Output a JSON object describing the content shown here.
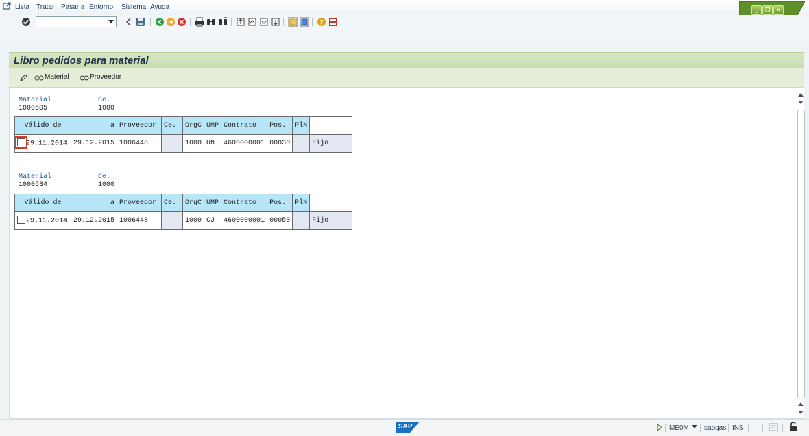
{
  "menu": [
    "Lista",
    "Tratar",
    "Pasar a",
    "Entorno",
    "Sistema",
    "Ayuda"
  ],
  "command_field": {
    "value": ""
  },
  "title": "Libro pedidos para material",
  "app_toolbar": {
    "edit_icon": "pencil-icon",
    "buttons": [
      "Material",
      "Proveedor"
    ]
  },
  "blocks": [
    {
      "material_label": "Material",
      "plant_label": "Ce.",
      "material": "1000505",
      "plant": "1000",
      "columns": [
        "Válido de",
        "a",
        "Proveedor",
        "Ce.",
        "OrgC",
        "UMP",
        "Contrato",
        "Pos.",
        "PlN"
      ],
      "row": {
        "valid_from": "29.11.2014",
        "valid_to": "29.12.2015",
        "vendor": "1006448",
        "plant": "",
        "purch_org": "1000",
        "unit": "UN",
        "contract": "4600000001",
        "item": "00030",
        "pln": "",
        "type": "Fijo"
      }
    },
    {
      "material_label": "Material",
      "plant_label": "Ce.",
      "material": "1000534",
      "plant": "1000",
      "columns": [
        "Válido de",
        "a",
        "Proveedor",
        "Ce.",
        "OrgC",
        "UMP",
        "Contrato",
        "Pos.",
        "PlN"
      ],
      "row": {
        "valid_from": "29.11.2014",
        "valid_to": "29.12.2015",
        "vendor": "1006448",
        "plant": "",
        "purch_org": "1000",
        "unit": "CJ",
        "contract": "4600000001",
        "item": "00050",
        "pln": "",
        "type": "Fijo"
      }
    }
  ],
  "status": {
    "logo": "SAP",
    "transaction": "ME0M",
    "server": "sapgas",
    "mode": "INS"
  },
  "colors": {
    "title_bg": "#d9e7c6",
    "header_cell": "#b6e6f7",
    "label_blue": "#1a5aa0"
  }
}
